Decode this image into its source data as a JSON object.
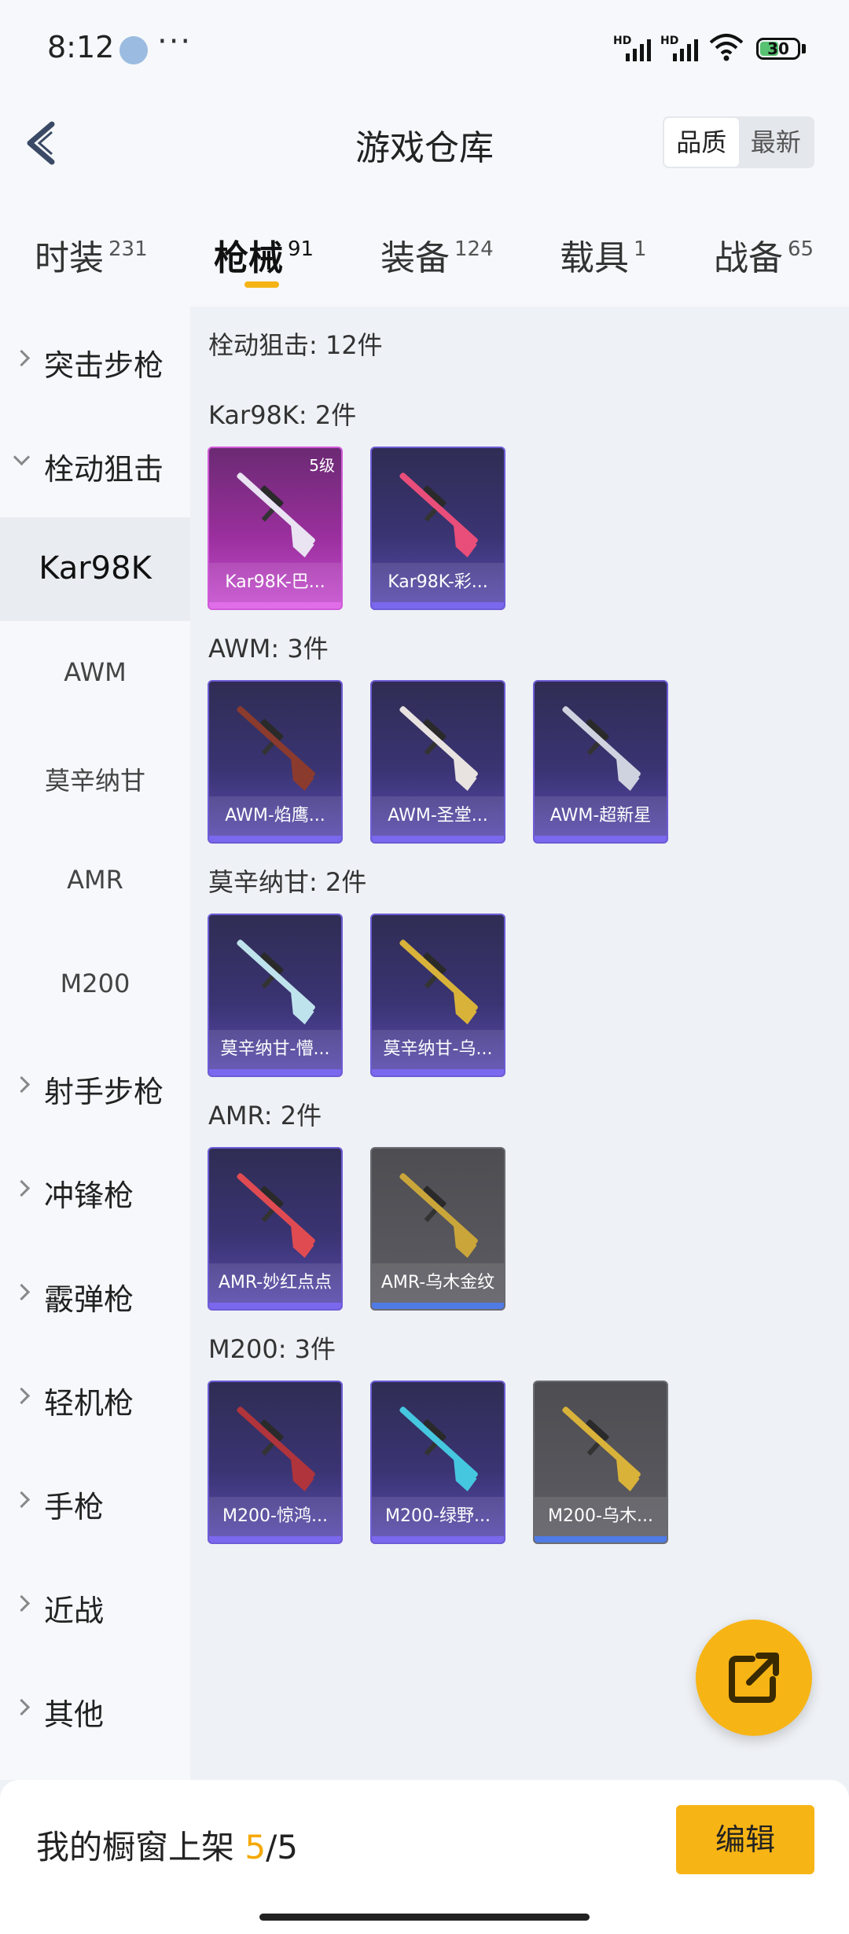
{
  "status_bar": {
    "time": "8:12",
    "battery": "30",
    "network": [
      "HD",
      "HD"
    ]
  },
  "header": {
    "title": "游戏仓库",
    "sort": [
      "品质",
      "最新"
    ],
    "sort_active": 0
  },
  "tabs": [
    {
      "label": "时装",
      "count": "231"
    },
    {
      "label": "枪械",
      "count": "91"
    },
    {
      "label": "装备",
      "count": "124"
    },
    {
      "label": "载具",
      "count": "1"
    },
    {
      "label": "战备",
      "count": "65"
    }
  ],
  "active_tab": 1,
  "sidebar": [
    {
      "label": "突击步枪",
      "type": "category"
    },
    {
      "label": "栓动狙击",
      "type": "category",
      "expanded": true
    },
    {
      "label": "Kar98K",
      "type": "sub",
      "selected": true
    },
    {
      "label": "AWM",
      "type": "sub"
    },
    {
      "label": "莫辛纳甘",
      "type": "sub"
    },
    {
      "label": "AMR",
      "type": "sub"
    },
    {
      "label": "M200",
      "type": "sub"
    },
    {
      "label": "射手步枪",
      "type": "category"
    },
    {
      "label": "冲锋枪",
      "type": "category"
    },
    {
      "label": "霰弹枪",
      "type": "category"
    },
    {
      "label": "轻机枪",
      "type": "category"
    },
    {
      "label": "手枪",
      "type": "category"
    },
    {
      "label": "近战",
      "type": "category"
    },
    {
      "label": "其他",
      "type": "category"
    }
  ],
  "content": {
    "section_title": "栓动狙击: 12件",
    "groups": [
      {
        "title": "Kar98K: 2件",
        "items": [
          {
            "name": "Kar98K-巴...",
            "rarity": "pink",
            "level": "5级",
            "gun_color": "#e9e3f2"
          },
          {
            "name": "Kar98K-彩...",
            "rarity": "purple",
            "gun_color": "#e94e7a"
          }
        ]
      },
      {
        "title": "AWM: 3件",
        "items": [
          {
            "name": "AWM-焰鹰...",
            "rarity": "purple",
            "gun_color": "#8b3a2e"
          },
          {
            "name": "AWM-圣堂...",
            "rarity": "purple",
            "gun_color": "#e8e3e0"
          },
          {
            "name": "AWM-超新星",
            "rarity": "purple",
            "gun_color": "#cfd3e0"
          }
        ]
      },
      {
        "title": "莫辛纳甘: 2件",
        "items": [
          {
            "name": "莫辛纳甘-懵...",
            "rarity": "purple",
            "gun_color": "#bfe3ec"
          },
          {
            "name": "莫辛纳甘-乌...",
            "rarity": "purple",
            "gun_color": "#d9b23a"
          }
        ]
      },
      {
        "title": "AMR: 2件",
        "items": [
          {
            "name": "AMR-妙红点点",
            "rarity": "purple",
            "gun_color": "#e04b52"
          },
          {
            "name": "AMR-乌木金纹",
            "rarity": "grey",
            "gun_color": "#caa63a"
          }
        ]
      },
      {
        "title": "M200: 3件",
        "items": [
          {
            "name": "M200-惊鸿...",
            "rarity": "purple",
            "gun_color": "#b0343c"
          },
          {
            "name": "M200-绿野...",
            "rarity": "purple",
            "gun_color": "#46c7e0"
          },
          {
            "name": "M200-乌木...",
            "rarity": "grey",
            "gun_color": "#d9b23a"
          }
        ]
      }
    ]
  },
  "bottom_bar": {
    "label": "我的橱窗上架",
    "count": "5",
    "total": "/5",
    "edit": "编辑"
  },
  "icons": [
    "back-arrow-icon",
    "share-external-icon",
    "wifi-icon",
    "signal-icon",
    "battery-icon",
    "chevron-right-icon",
    "chevron-down-icon"
  ]
}
